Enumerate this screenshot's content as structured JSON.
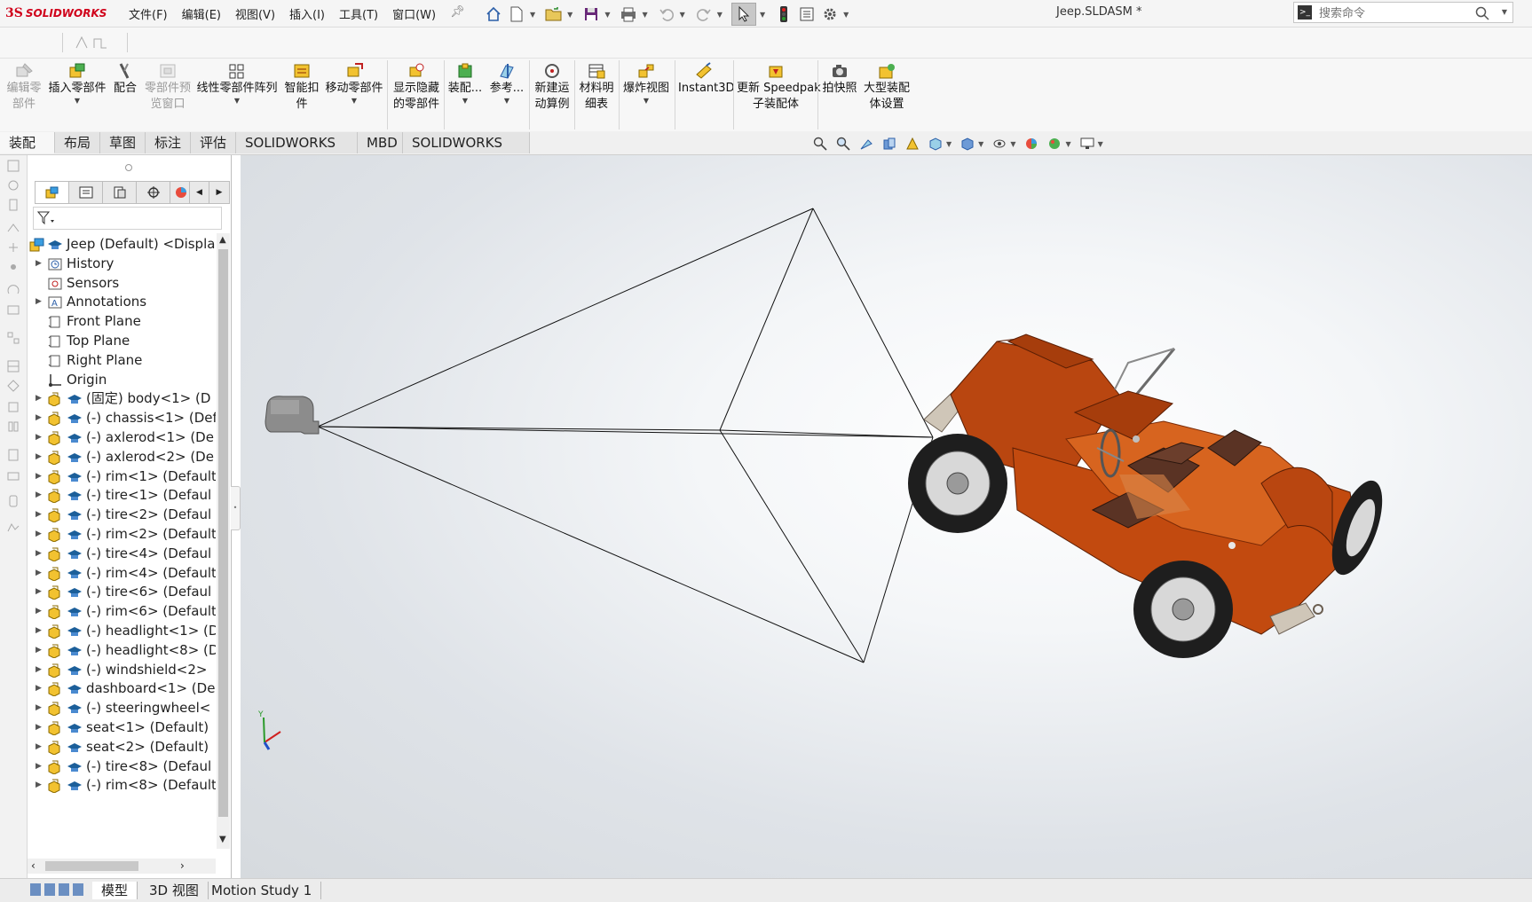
{
  "app": {
    "brand_prefix": "3S",
    "brand": "SOLIDWORKS",
    "document_title": "Jeep.SLDASM *"
  },
  "menus": [
    "文件(F)",
    "编辑(E)",
    "视图(V)",
    "插入(I)",
    "工具(T)",
    "窗口(W)"
  ],
  "search": {
    "placeholder": "搜索命令"
  },
  "commands": [
    {
      "label": "编辑零\n部件",
      "icon": "edit-component-icon",
      "enabled": false
    },
    {
      "label": "插入零部件",
      "icon": "insert-component-icon",
      "enabled": true
    },
    {
      "label": "配合",
      "icon": "mate-icon",
      "enabled": true
    },
    {
      "label": "零部件预\n览窗口",
      "icon": "component-preview-icon",
      "enabled": false
    },
    {
      "label": "线性零部件阵列",
      "icon": "linear-pattern-icon",
      "enabled": true
    },
    {
      "label": "智能扣\n件",
      "icon": "smart-fastener-icon",
      "enabled": true
    },
    {
      "label": "移动零部件",
      "icon": "move-component-icon",
      "enabled": true
    },
    {
      "label": "显示隐藏\n的零部件",
      "icon": "show-hidden-icon",
      "enabled": true
    },
    {
      "label": "装配...",
      "icon": "assembly-features-icon",
      "enabled": true
    },
    {
      "label": "参考...",
      "icon": "reference-geometry-icon",
      "enabled": true
    },
    {
      "label": "新建运\n动算例",
      "icon": "motion-study-icon",
      "enabled": true
    },
    {
      "label": "材料明\n细表",
      "icon": "bom-icon",
      "enabled": true
    },
    {
      "label": "爆炸视图",
      "icon": "exploded-view-icon",
      "enabled": true
    },
    {
      "label": "Instant3D",
      "icon": "instant3d-icon",
      "enabled": true
    },
    {
      "label": "更新 Speedpak\n子装配体",
      "icon": "speedpak-icon",
      "enabled": true
    },
    {
      "label": "拍快照",
      "icon": "snapshot-icon",
      "enabled": true
    },
    {
      "label": "大型装配\n体设置",
      "icon": "large-assembly-icon",
      "enabled": true
    }
  ],
  "tabs": [
    "装配体",
    "布局",
    "草图",
    "标注",
    "评估",
    "SOLIDWORKS 插件",
    "MBD",
    "SOLIDWORKS CAM"
  ],
  "tree": {
    "root": "Jeep (Default) <Displa",
    "items": [
      {
        "label": "History",
        "icon": "history-icon",
        "expandable": true
      },
      {
        "label": "Sensors",
        "icon": "sensors-icon",
        "expandable": false
      },
      {
        "label": "Annotations",
        "icon": "annotations-icon",
        "expandable": true
      },
      {
        "label": "Front Plane",
        "icon": "plane-icon",
        "expandable": false
      },
      {
        "label": "Top Plane",
        "icon": "plane-icon",
        "expandable": false
      },
      {
        "label": "Right Plane",
        "icon": "plane-icon",
        "expandable": false
      },
      {
        "label": "Origin",
        "icon": "origin-icon",
        "expandable": false
      },
      {
        "label": "(固定) body<1> (D",
        "icon": "part-icon",
        "expandable": true
      },
      {
        "label": "(-) chassis<1> (Def",
        "icon": "part-icon",
        "expandable": true
      },
      {
        "label": "(-) axlerod<1> (De",
        "icon": "part-icon",
        "expandable": true
      },
      {
        "label": "(-) axlerod<2> (De",
        "icon": "part-icon",
        "expandable": true
      },
      {
        "label": "(-) rim<1> (Default",
        "icon": "part-icon",
        "expandable": true
      },
      {
        "label": "(-) tire<1> (Defaul",
        "icon": "part-icon",
        "expandable": true
      },
      {
        "label": "(-) tire<2> (Defaul",
        "icon": "part-icon",
        "expandable": true
      },
      {
        "label": "(-) rim<2> (Default",
        "icon": "part-icon",
        "expandable": true
      },
      {
        "label": "(-) tire<4> (Defaul",
        "icon": "part-icon",
        "expandable": true
      },
      {
        "label": "(-) rim<4> (Default",
        "icon": "part-icon",
        "expandable": true
      },
      {
        "label": "(-) tire<6> (Defaul",
        "icon": "part-icon",
        "expandable": true
      },
      {
        "label": "(-) rim<6> (Default",
        "icon": "part-icon",
        "expandable": true
      },
      {
        "label": "(-) headlight<1> (D",
        "icon": "part-icon",
        "expandable": true
      },
      {
        "label": "(-) headlight<8> (D",
        "icon": "part-icon",
        "expandable": true
      },
      {
        "label": "(-) windshield<2>",
        "icon": "part-icon",
        "expandable": true
      },
      {
        "label": "dashboard<1> (De",
        "icon": "part-icon",
        "expandable": true
      },
      {
        "label": "(-) steeringwheel<",
        "icon": "part-icon",
        "expandable": true
      },
      {
        "label": "seat<1> (Default)",
        "icon": "part-icon",
        "expandable": true
      },
      {
        "label": "seat<2> (Default)",
        "icon": "part-icon",
        "expandable": true
      },
      {
        "label": "(-) tire<8> (Defaul",
        "icon": "part-icon",
        "expandable": true
      },
      {
        "label": "(-) rim<8> (Default",
        "icon": "part-icon",
        "expandable": true
      }
    ]
  },
  "triad": {
    "x": "X",
    "y": "Y"
  },
  "bottom_tabs": [
    "模型",
    "3D 视图",
    "Motion Study 1"
  ],
  "colors": {
    "accent_red": "#d0021b",
    "jeep_body": "#c24a0f",
    "seat": "#5a3324",
    "tire": "#1e1e1e",
    "plane_icon_yellow": "#f5c518"
  }
}
